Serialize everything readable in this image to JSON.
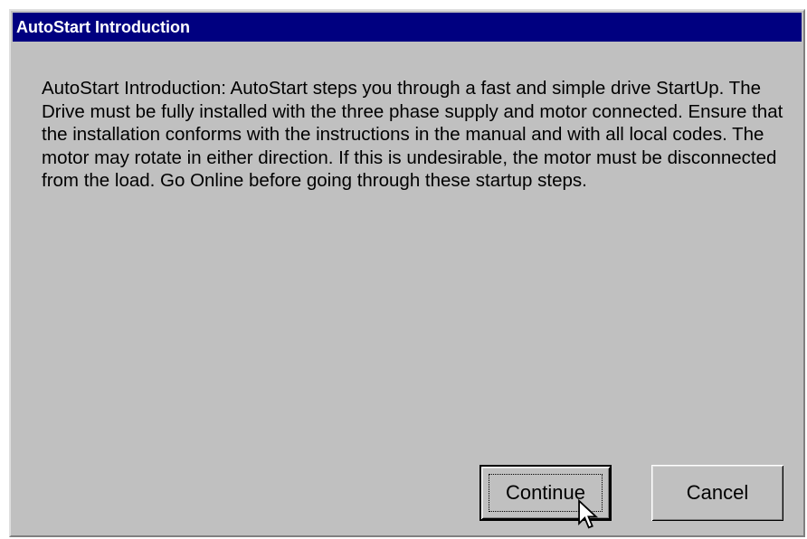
{
  "window": {
    "title": "AutoStart Introduction"
  },
  "message": {
    "text": "AutoStart Introduction:  AutoStart steps you through a fast and simple drive StartUp.  The Drive must be fully installed with the three phase supply and motor connected.  Ensure that the installation conforms with the instructions in the manual and with all local codes.  The motor may rotate in either direction.  If this is undesirable, the motor must be disconnected from the load.  Go Online before going through these startup steps."
  },
  "buttons": {
    "continue_label": "Continue",
    "cancel_label": "Cancel"
  },
  "cursor": {
    "icon": "arrow-pointer-icon"
  },
  "colors": {
    "title_bar": "#000080",
    "dialog_face": "#c0c0c0",
    "title_text": "#ffffff"
  }
}
